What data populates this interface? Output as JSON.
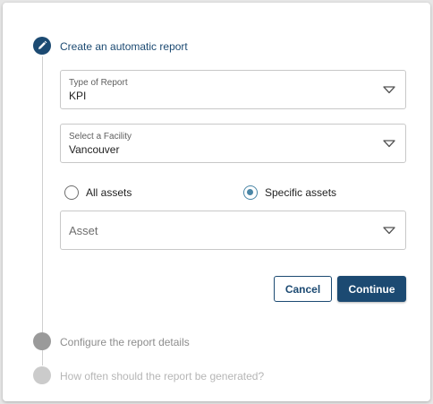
{
  "steps": [
    {
      "title": "Create an automatic report",
      "state": "active",
      "icon": "pencil-icon"
    },
    {
      "title": "Configure the report details",
      "state": "pending"
    },
    {
      "title": "How often should the report be generated?",
      "state": "pending"
    }
  ],
  "form": {
    "report_type": {
      "label": "Type of Report",
      "value": "KPI"
    },
    "facility": {
      "label": "Select a Facility",
      "value": "Vancouver"
    },
    "asset_scope": {
      "options": [
        "All assets",
        "Specific assets"
      ],
      "selected": "Specific assets"
    },
    "asset": {
      "placeholder": "Asset"
    }
  },
  "actions": {
    "cancel_label": "Cancel",
    "continue_label": "Continue"
  },
  "colors": {
    "primary": "#1c4a72",
    "radio_accent": "#4a86a6",
    "step_pending": "#9a9a9a",
    "step_future": "#cbcbcb"
  }
}
